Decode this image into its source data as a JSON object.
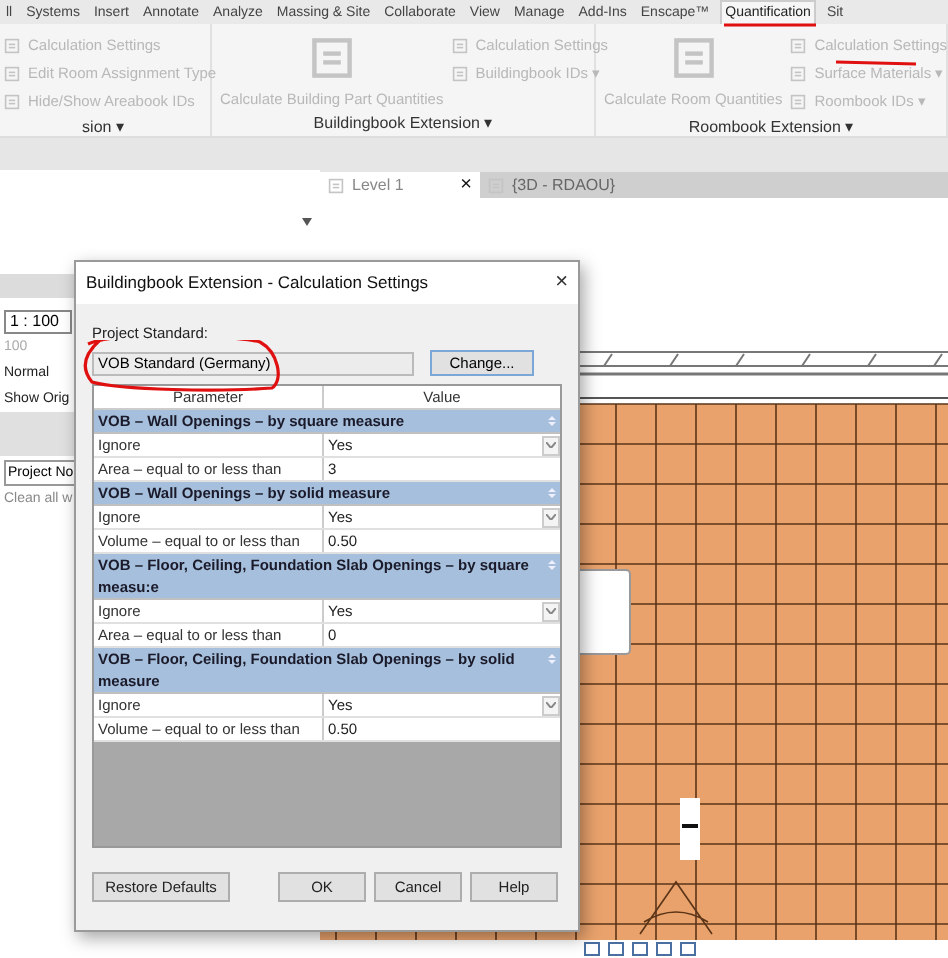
{
  "menu_tabs": [
    {
      "label": "ll",
      "selected": false
    },
    {
      "label": "Systems",
      "selected": false
    },
    {
      "label": "Insert",
      "selected": false
    },
    {
      "label": "Annotate",
      "selected": false
    },
    {
      "label": "Analyze",
      "selected": false
    },
    {
      "label": "Massing & Site",
      "selected": false
    },
    {
      "label": "Collaborate",
      "selected": false
    },
    {
      "label": "View",
      "selected": false
    },
    {
      "label": "Manage",
      "selected": false
    },
    {
      "label": "Add-Ins",
      "selected": false
    },
    {
      "label": "Enscape™",
      "selected": false
    },
    {
      "label": "Quantification",
      "selected": true
    },
    {
      "label": "Sit",
      "selected": false
    }
  ],
  "ribbon_panels": [
    {
      "title": "sion ▾",
      "small": [
        {
          "label": "Calculation Settings",
          "disabled": true
        },
        {
          "label": "Edit Room Assignment Type",
          "disabled": true
        },
        {
          "label": "Hide/Show Areabook IDs",
          "disabled": true
        }
      ]
    },
    {
      "title": "Buildingbook Extension ▾",
      "large": {
        "label": "Calculate Building Part Quantities",
        "disabled": true
      },
      "small": [
        {
          "label": "Calculation Settings",
          "disabled": true
        },
        {
          "label": "Buildingbook IDs ▾",
          "disabled": true
        }
      ]
    },
    {
      "title": "Roombook Extension ▾",
      "large": {
        "label": "Calculate Room Quantities",
        "disabled": true
      },
      "small": [
        {
          "label": "Calculation Settings",
          "disabled": true
        },
        {
          "label": "Surface Materials ▾",
          "disabled": true
        },
        {
          "label": "Roombook IDs ▾",
          "disabled": true
        }
      ]
    }
  ],
  "properties": {
    "scale": "1 : 100",
    "rows": [
      "100",
      "Normal",
      "Show Orig"
    ],
    "section": "Project No",
    "row_after": "Clean all w"
  },
  "view_tabs": [
    {
      "label": "Level 1",
      "close": "×",
      "selected": true
    },
    {
      "label": "{3D - RDAOU}",
      "selected": false
    }
  ],
  "dialog": {
    "title": "Buildingbook Extension - Calculation Settings",
    "close": "×",
    "standard_label": "Project Standard:",
    "standard_value": "VOB Standard (Germany)",
    "change_button": "Change...",
    "columns": [
      "Parameter",
      "Value"
    ],
    "groups": [
      {
        "title": "VOB – Wall Openings – by square measure",
        "rows": [
          {
            "kind": "dropdown",
            "parameter": "Ignore",
            "value": "Yes"
          },
          {
            "kind": "text",
            "parameter": "Area – equal to or less than",
            "value": "3"
          }
        ]
      },
      {
        "title": "VOB – Wall Openings – by solid measure",
        "rows": [
          {
            "kind": "dropdown",
            "parameter": "Ignore",
            "value": "Yes"
          },
          {
            "kind": "text",
            "parameter": "Volume – equal to or less than",
            "value": "0.50"
          }
        ]
      },
      {
        "title": "VOB – Floor, Ceiling, Foundation Slab Openings – by square measu:e",
        "rows": [
          {
            "kind": "dropdown",
            "parameter": "Ignore",
            "value": "Yes"
          },
          {
            "kind": "text",
            "parameter": "Area – equal to or less than",
            "value": "0"
          }
        ]
      },
      {
        "title": "VOB – Floor, Ceiling, Foundation Slab Openings – by solid measure",
        "rows": [
          {
            "kind": "dropdown",
            "parameter": "Ignore",
            "value": "Yes"
          },
          {
            "kind": "text",
            "parameter": "Volume – equal to or less than",
            "value": "0.50"
          }
        ]
      }
    ],
    "buttons": [
      "Restore Defaults",
      "OK",
      "Cancel",
      "Help"
    ]
  }
}
